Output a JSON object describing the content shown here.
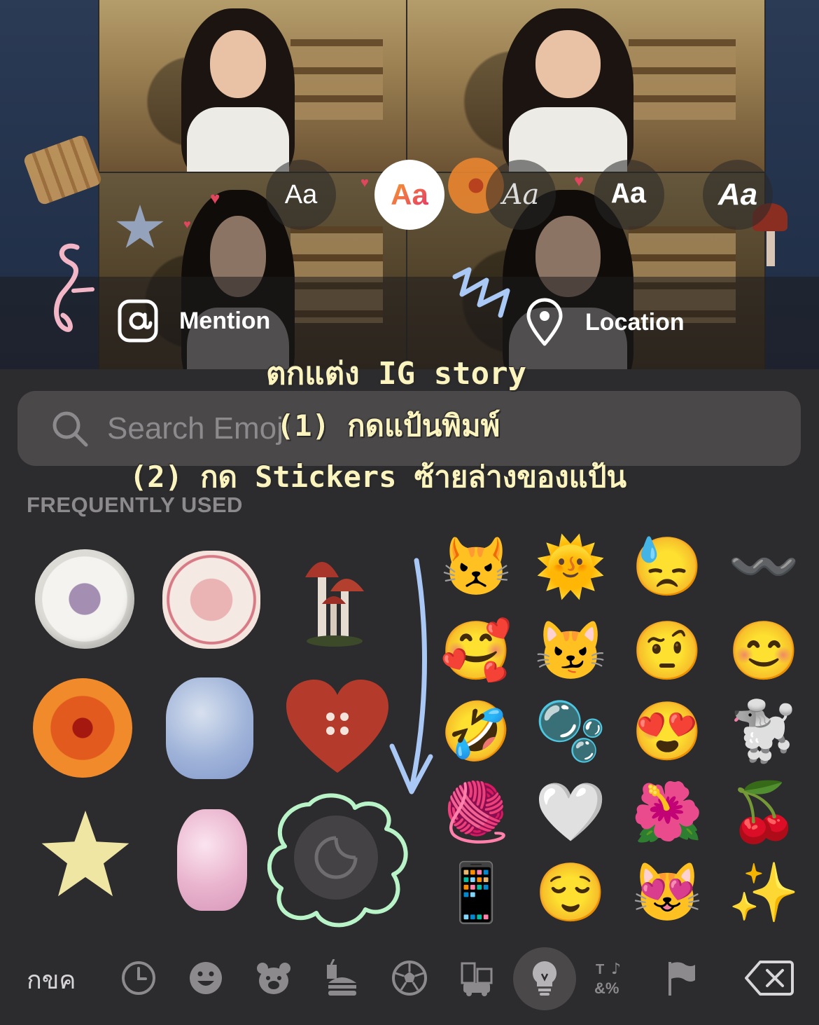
{
  "fonts": {
    "styles": [
      "Aa",
      "Aa",
      "Aa",
      "Aa",
      "Aa"
    ],
    "selected_index": 1
  },
  "tags": {
    "mention_label": "Mention",
    "location_label": "Location"
  },
  "annotations": {
    "line1": "ตกแต่ง IG story",
    "line2": "(1) กดแป้นพิมพ์",
    "line3": "(2) กด Stickers ซ้ายล่างของแป้น"
  },
  "search": {
    "placeholder": "Search Emoji"
  },
  "section_title": "FREQUENTLY USED",
  "emoji_grid": [
    "😾",
    "🌞",
    "😓",
    "〰️",
    "🥰",
    "😼",
    "🤨",
    "😊",
    "🤣",
    "🫧",
    "😍",
    "🐩",
    "🧶",
    "🤍",
    "🌺",
    "🍒",
    "📱",
    "😌",
    "😻",
    "✨"
  ],
  "keyboard_bar": {
    "language_label": "กขค",
    "selected_category": "objects",
    "categories": [
      "recent",
      "smileys",
      "animals",
      "food",
      "activity",
      "travel",
      "objects",
      "symbols",
      "flags"
    ]
  },
  "colors": {
    "accent_gradient_start": "#f7a02a",
    "accent_gradient_end": "#e6336b",
    "annotation_text": "#fbf4bf",
    "sticker_circle_outline": "#b9f3c8",
    "arrow": "#a9c8f5"
  }
}
